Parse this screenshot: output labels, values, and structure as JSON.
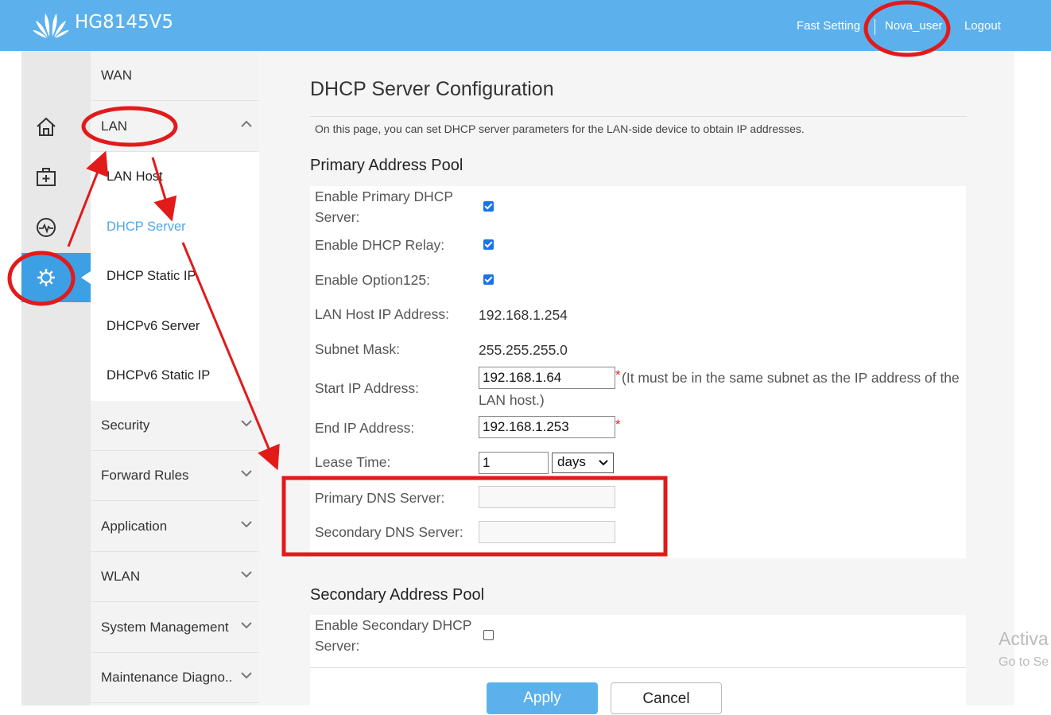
{
  "header": {
    "brand": "HG8145V5",
    "fast_setting": "Fast Setting",
    "username": "Nova_user",
    "logout": "Logout"
  },
  "icon_rail": {
    "items": [
      {
        "icon": "home-icon"
      },
      {
        "icon": "first-aid-icon"
      },
      {
        "icon": "pulse-icon"
      },
      {
        "icon": "gear-icon",
        "active": true
      }
    ]
  },
  "menu": {
    "wan": "WAN",
    "lan": "LAN",
    "lan_sub": [
      "LAN Host",
      "DHCP Server",
      "DHCP Static IP",
      "DHCPv6 Server",
      "DHCPv6 Static IP"
    ],
    "active_sub": "DHCP Server",
    "items_below": [
      "Security",
      "Forward Rules",
      "Application",
      "WLAN",
      "System Management",
      "Maintenance Diagno.."
    ]
  },
  "page": {
    "title": "DHCP Server Configuration",
    "description": "On this page, you can set DHCP server parameters for the LAN-side device to obtain IP addresses."
  },
  "primary_pool": {
    "heading": "Primary Address Pool",
    "enable_primary_label": "Enable Primary DHCP Server:",
    "enable_primary": true,
    "enable_relay_label": "Enable DHCP Relay:",
    "enable_relay": true,
    "enable_option125_label": "Enable Option125:",
    "enable_option125": true,
    "lan_host_ip_label": "LAN Host IP Address:",
    "lan_host_ip": "192.168.1.254",
    "subnet_mask_label": "Subnet Mask:",
    "subnet_mask": "255.255.255.0",
    "start_ip_label": "Start IP Address:",
    "start_ip": "192.168.1.64",
    "start_ip_hint": "(It must be in the same subnet as the IP address of the LAN host.)",
    "end_ip_label": "End IP Address:",
    "end_ip": "192.168.1.253",
    "required_mark": "*",
    "lease_time_label": "Lease Time:",
    "lease_time": "1",
    "lease_unit": "days",
    "primary_dns_label": "Primary DNS Server:",
    "primary_dns": "",
    "secondary_dns_label": "Secondary DNS Server:",
    "secondary_dns": ""
  },
  "secondary_pool": {
    "heading": "Secondary Address Pool",
    "enable_secondary_label": "Enable Secondary DHCP Server:",
    "enable_secondary": false
  },
  "actions": {
    "apply": "Apply",
    "cancel": "Cancel"
  },
  "watermark": {
    "line1": "Activa",
    "line2": "Go to Se"
  },
  "colors": {
    "header_blue": "#5cb1ec",
    "active_rail": "#3d9fe4",
    "active_link": "#4ea7e8",
    "annotation_red": "#e21a1a"
  }
}
